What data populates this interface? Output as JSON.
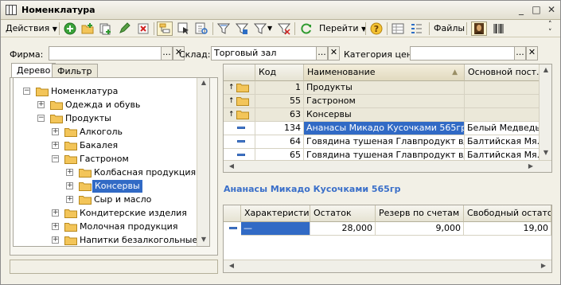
{
  "window": {
    "title": "Номенклатура"
  },
  "toolbar": {
    "actions_label": "Действия",
    "navigate_label": "Перейти",
    "files_label": "Файлы"
  },
  "filters": {
    "firm_label": "Фирма:",
    "firm_value": "",
    "warehouse_label": "Склад:",
    "warehouse_value": "Торговый зал",
    "price_category_label": "Категория цен:",
    "price_category_value": ""
  },
  "tabs": [
    {
      "label": "Дерево"
    },
    {
      "label": "Фильтр"
    }
  ],
  "tree": {
    "root": "Номенклатура",
    "items": [
      {
        "label": "Одежда и обувь",
        "expander": "+"
      },
      {
        "label": "Продукты",
        "expander": "−"
      },
      {
        "label": "Алкоголь",
        "expander": "+"
      },
      {
        "label": "Бакалея",
        "expander": "+"
      },
      {
        "label": "Гастроном",
        "expander": "−"
      },
      {
        "label": "Колбасная продукция",
        "expander": "+"
      },
      {
        "label": "Консервы",
        "expander": "+"
      },
      {
        "label": "Сыр и масло",
        "expander": "+"
      },
      {
        "label": "Кондитерские изделия",
        "expander": "+"
      },
      {
        "label": "Молочная продукция",
        "expander": "+"
      },
      {
        "label": "Напитки безалкогольные",
        "expander": "+"
      }
    ]
  },
  "items_table": {
    "columns": [
      "Код",
      "Наименование",
      "Основной пост..."
    ],
    "rows": [
      {
        "code": "1",
        "name": "Продукты",
        "supplier": ""
      },
      {
        "code": "55",
        "name": "Гастроном",
        "supplier": ""
      },
      {
        "code": "63",
        "name": "Консервы",
        "supplier": ""
      },
      {
        "code": "134",
        "name": "Ананасы Микадо Кусочками 565гр",
        "supplier": "Белый Медведь"
      },
      {
        "code": "64",
        "name": "Говядина тушеная Главпродукт в/с ...",
        "supplier": "Балтийская Мя..."
      },
      {
        "code": "65",
        "name": "Говядина тушеная Главпродукт в/с ...",
        "supplier": "Балтийская Мя..."
      }
    ]
  },
  "selected_item_title": "Ананасы Микадо Кусочками 565гр",
  "stock_table": {
    "columns": [
      "Характеристи...",
      "Остаток",
      "Резерв по счетам",
      "Свободный остаток"
    ],
    "rows": [
      {
        "characteristic": "—",
        "balance": "28,000",
        "reserve": "9,000",
        "free": "19,00"
      }
    ]
  },
  "colors": {
    "accent": "#316ac5",
    "title_link": "#3a6fc9",
    "folder": "#f3c559"
  }
}
